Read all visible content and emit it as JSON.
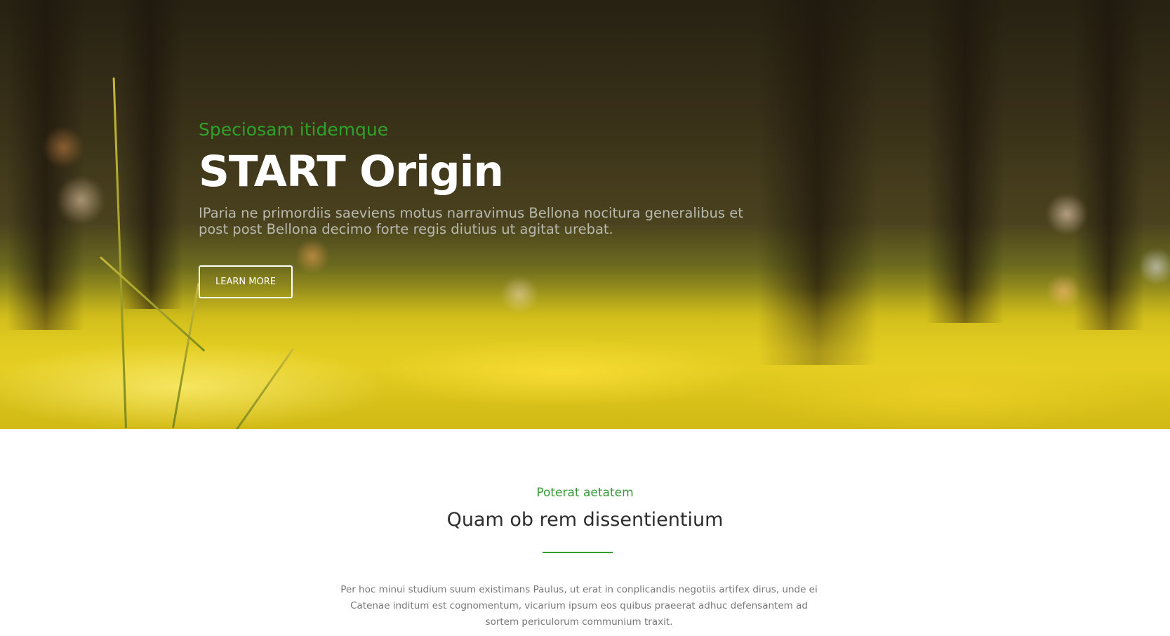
{
  "hero": {
    "eyebrow": "Speciosam itidemque",
    "title": "START Origin",
    "text": "IParia ne primordiis saeviens motus narravimus Bellona nocitura generalibus et post post Bellona decimo forte regis diutius ut agitat urebat.",
    "button_label": "LEARN MORE",
    "background": "blurred forest with yellow grass"
  },
  "intro": {
    "eyebrow": "Poterat aetatem",
    "title": "Quam ob rem dissentientium",
    "text": "Per hoc minui studium suum existimans Paulus, ut erat in conplicandis negotiis artifex dirus, unde ei Catenae inditum est cognomentum, vicarium ipsum eos quibus praeerat adhuc defensantem ad sortem periculorum communium traxit."
  },
  "colors": {
    "accent": "#2fa12a",
    "heading": "#2d2d2d",
    "body_text": "#777777"
  }
}
